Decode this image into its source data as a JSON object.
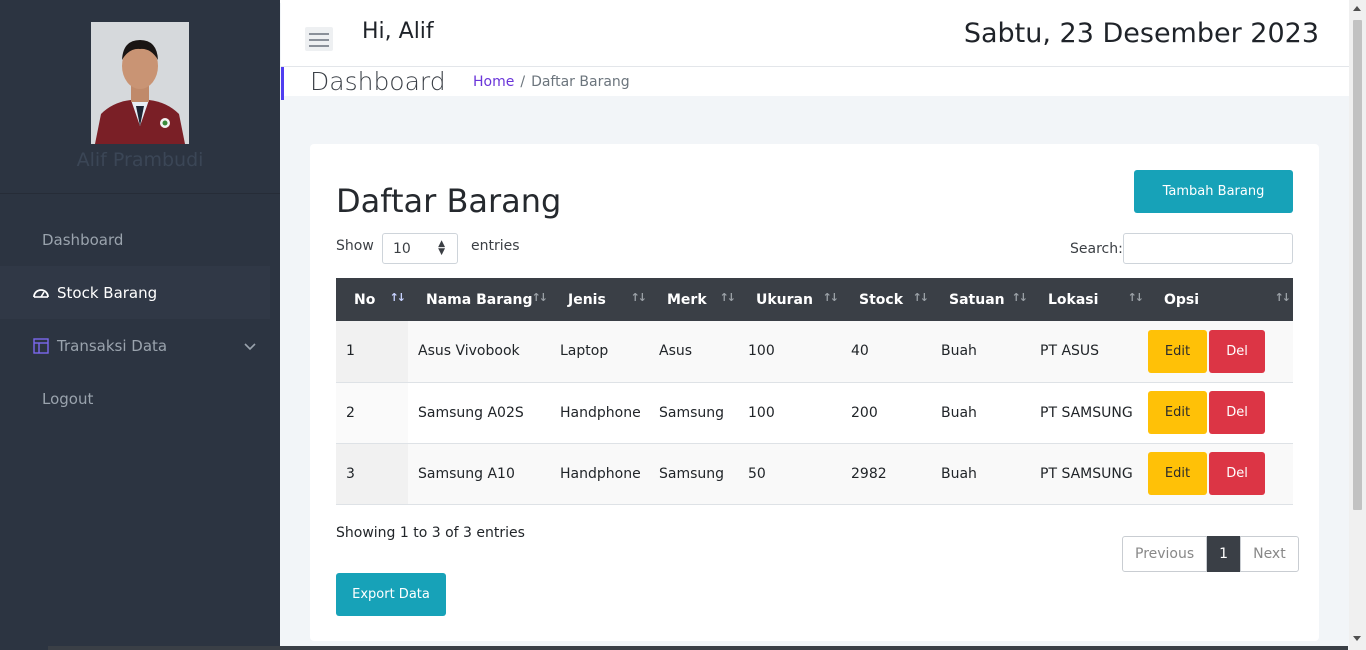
{
  "sidebar": {
    "profile_name": "Alif Prambudi",
    "items": [
      {
        "label": "Dashboard"
      },
      {
        "label": "Stock Barang"
      },
      {
        "label": "Transaksi Data"
      },
      {
        "label": "Logout"
      }
    ]
  },
  "header": {
    "greeting": "Hi, Alif",
    "date": "Sabtu, 23 Desember 2023"
  },
  "breadcrumb": {
    "title": "Dashboard",
    "home": "Home",
    "separator": "/",
    "current": "Daftar Barang"
  },
  "card": {
    "title": "Daftar Barang",
    "add_button": "Tambah Barang",
    "show_label": "Show",
    "show_value": "10",
    "entries_label": "entries",
    "search_label": "Search:",
    "search_value": "",
    "info": "Showing 1 to 3 of 3 entries",
    "export_button": "Export Data"
  },
  "table": {
    "columns": [
      "No",
      "Nama Barang",
      "Jenis",
      "Merk",
      "Ukuran",
      "Stock",
      "Satuan",
      "Lokasi",
      "Opsi"
    ],
    "rows": [
      {
        "no": "1",
        "nama": "Asus Vivobook",
        "jenis": "Laptop",
        "merk": "Asus",
        "ukuran": "100",
        "stock": "40",
        "satuan": "Buah",
        "lokasi": "PT ASUS"
      },
      {
        "no": "2",
        "nama": "Samsung A02S",
        "jenis": "Handphone",
        "merk": "Samsung",
        "ukuran": "100",
        "stock": "200",
        "satuan": "Buah",
        "lokasi": "PT SAMSUNG"
      },
      {
        "no": "3",
        "nama": "Samsung A10",
        "jenis": "Handphone",
        "merk": "Samsung",
        "ukuran": "50",
        "stock": "2982",
        "satuan": "Buah",
        "lokasi": "PT SAMSUNG"
      }
    ],
    "edit_label": "Edit",
    "delete_label": "Del"
  },
  "pagination": {
    "previous": "Previous",
    "current": "1",
    "next": "Next"
  },
  "colors": {
    "sidebar_bg": "#2c3441",
    "accent": "#17a2b8",
    "edit": "#ffc107",
    "delete": "#dc3545",
    "table_header": "#3a3f46",
    "link": "#6a35d9"
  },
  "icons": [
    "dashboard-gauge-icon",
    "table-icon",
    "chevron-down-icon",
    "hamburger-icon",
    "sort-icon"
  ]
}
